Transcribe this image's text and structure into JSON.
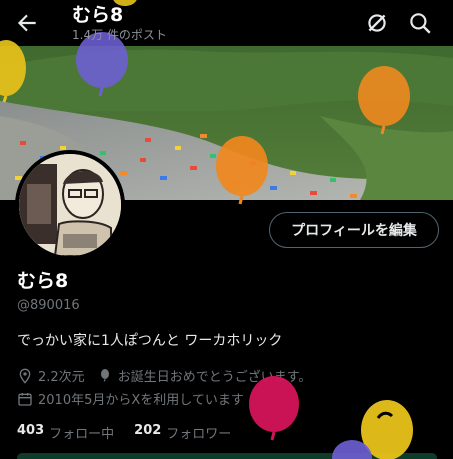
{
  "header": {
    "title": "むら8",
    "subtitle": "1.4万 件のポスト",
    "icons": [
      "back-arrow-icon",
      "grok-icon",
      "search-icon"
    ]
  },
  "profile": {
    "name": "むら8",
    "handle": "@890016",
    "bio": "でっかい家に1人ぽつんと ワーカホリック",
    "location": "2.2次元",
    "birthday": "お誕生日おめでとうございます。",
    "joined": "2010年5月からXを利用しています",
    "edit_button": "プロフィールを編集"
  },
  "stats": {
    "following_count": "403",
    "following_label": "フォロー中",
    "followers_count": "202",
    "followers_label": "フォロワー"
  },
  "colors": {
    "background": "#000000",
    "text": "#e7e9ea",
    "muted": "#71767b",
    "balloon_purple": "#6e5fd6",
    "balloon_orange": "#f0881e",
    "balloon_yellow": "#e8c21a",
    "balloon_magenta": "#d4145a"
  }
}
